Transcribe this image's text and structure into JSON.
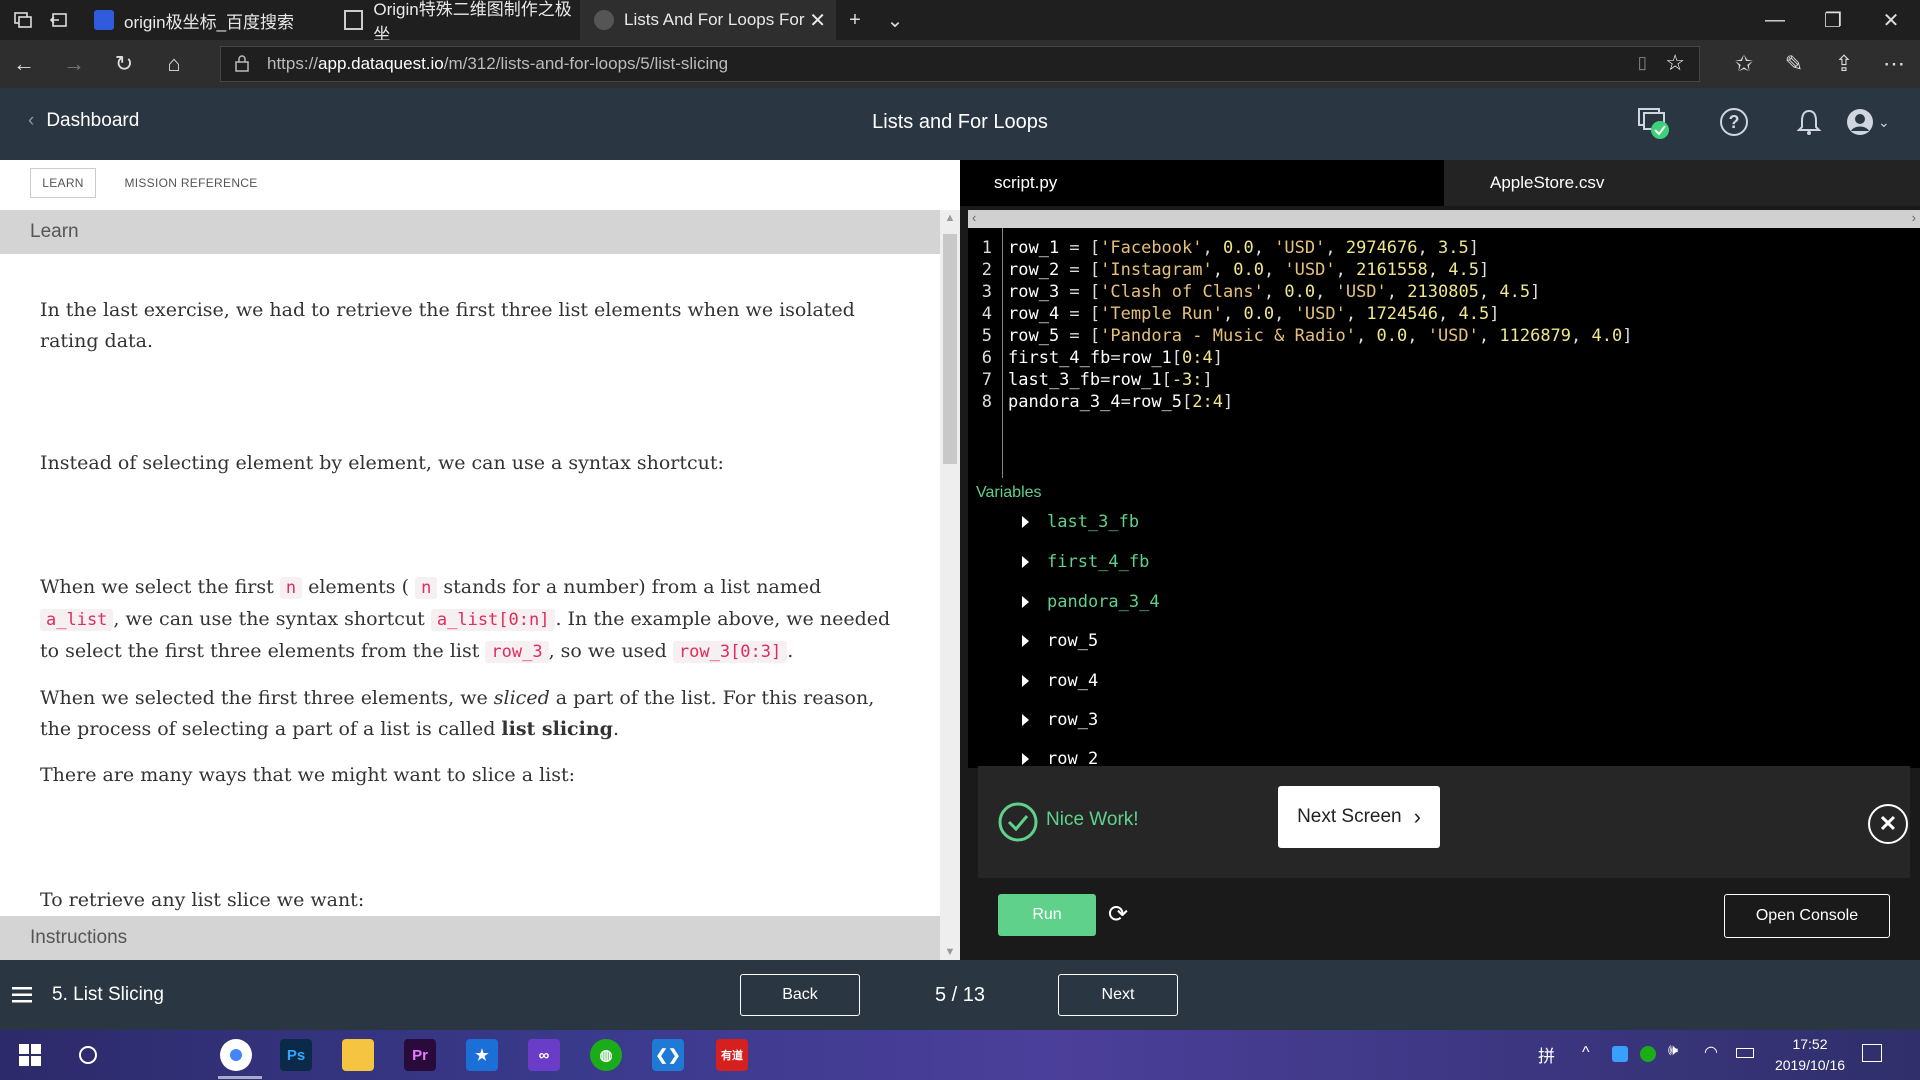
{
  "browser": {
    "tabs": [
      {
        "title": "origin极坐标_百度搜索"
      },
      {
        "title": "Origin特殊二维图制作之极坐"
      },
      {
        "title": "Lists And For Loops For"
      }
    ],
    "url_prefix": "https://",
    "url_domain": "app.dataquest.io",
    "url_path": "/m/312/lists-and-for-loops/5/list-slicing"
  },
  "header": {
    "back_label": "Dashboard",
    "title": "Lists and For Loops"
  },
  "left": {
    "tabs": [
      "LEARN",
      "MISSION REFERENCE"
    ],
    "learn_heading": "Learn",
    "instructions_heading": "Instructions",
    "p1": "In the last exercise, we had to retrieve the first three list elements when we isolated rating data.",
    "p2": "Instead of selecting element by element, we can use a syntax shortcut:",
    "p3": {
      "t1": "When we select the first",
      "c1": "n",
      "t2": "elements (",
      "c2": "n",
      "t3": "stands for a number) from a list named",
      "c3": "a_list",
      "t4": ", we can use the syntax shortcut",
      "c4": "a_list[0:n]",
      "t5": ". In the example above, we needed to select the first three elements from the list",
      "c5": "row_3",
      "t6": ", so we used",
      "c6": "row_3[0:3]",
      "t7": "."
    },
    "p4": {
      "t1": "When we selected the first three elements, we",
      "em": "sliced",
      "t2": "a part of the list. For this reason, the process of selecting a part of a list is called",
      "strong": "list slicing",
      "t3": "."
    },
    "p5": "There are many ways that we might want to slice a list:",
    "p6": "To retrieve any list slice we want:"
  },
  "right": {
    "tabs": [
      "script.py",
      "AppleStore.csv"
    ],
    "code_lines": [
      {
        "num": "1",
        "var": "row_1",
        "name": "'Facebook'",
        "price": "0.0",
        "cur": "'USD'",
        "count": "2974676",
        "rating": "3.5"
      },
      {
        "num": "2",
        "var": "row_2",
        "name": "'Instagram'",
        "price": "0.0",
        "cur": "'USD'",
        "count": "2161558",
        "rating": "4.5"
      },
      {
        "num": "3",
        "var": "row_3",
        "name": "'Clash of Clans'",
        "price": "0.0",
        "cur": "'USD'",
        "count": "2130805",
        "rating": "4.5"
      },
      {
        "num": "4",
        "var": "row_4",
        "name": "'Temple Run'",
        "price": "0.0",
        "cur": "'USD'",
        "count": "1724546",
        "rating": "4.5"
      },
      {
        "num": "5",
        "var": "row_5",
        "name": "'Pandora - Music & Radio'",
        "price": "0.0",
        "cur": "'USD'",
        "count": "1126879",
        "rating": "4.0"
      }
    ],
    "slice_lines": [
      {
        "num": "6",
        "lhs": "first_4_fb",
        "rhs": "row_1",
        "idx": "0:4"
      },
      {
        "num": "7",
        "lhs": "last_3_fb",
        "rhs": "row_1",
        "idx": "-3:"
      },
      {
        "num": "8",
        "lhs": "pandora_3_4",
        "rhs": "row_5",
        "idx": "2:4"
      }
    ],
    "variables_label": "Variables",
    "variables": [
      "last_3_fb",
      "first_4_fb",
      "pandora_3_4",
      "row_5",
      "row_4",
      "row_3",
      "row_2"
    ],
    "nice_work": "Nice Work!",
    "next_screen": "Next Screen",
    "run": "Run",
    "open_console": "Open Console"
  },
  "footer": {
    "lesson": "5. List Slicing",
    "back": "Back",
    "progress": "5 / 13",
    "next": "Next"
  },
  "taskbar": {
    "time": "17:52",
    "date": "2019/10/16",
    "ime": "拼"
  },
  "colors": {
    "header_bg": "#2b3643",
    "accent_green": "#5fd18a",
    "code_pink": "#e02c5b"
  }
}
